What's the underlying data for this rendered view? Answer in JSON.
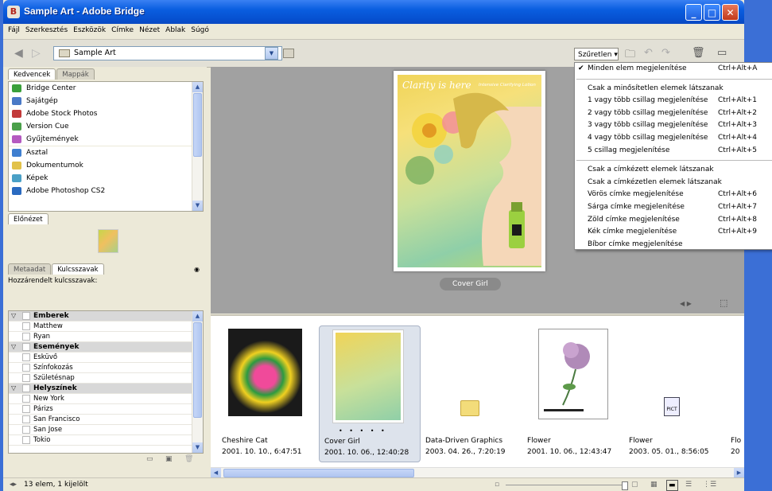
{
  "window": {
    "title": "Sample Art - Adobe Bridge"
  },
  "menubar": [
    "Fájl",
    "Szerkesztés",
    "Eszközök",
    "Címke",
    "Nézet",
    "Ablak",
    "Súgó"
  ],
  "path": {
    "current": "Sample Art"
  },
  "toolbar": {
    "filter_label": "Szűretlen"
  },
  "tabs": {
    "favorites": "Kedvencek",
    "folders": "Mappák",
    "preview": "Előnézet",
    "metadata": "Metaadat",
    "keywords": "Kulcsszavak"
  },
  "favorites": [
    {
      "label": "Bridge Center",
      "icon": "bridge-center-icon"
    },
    {
      "label": "Sajátgép",
      "icon": "computer-icon"
    },
    {
      "label": "Adobe Stock Photos",
      "icon": "stock-photos-icon"
    },
    {
      "label": "Version Cue",
      "icon": "version-cue-icon"
    },
    {
      "label": "Gyűjtemények",
      "icon": "collections-icon"
    },
    {
      "label": "Asztal",
      "icon": "desktop-icon"
    },
    {
      "label": "Dokumentumok",
      "icon": "documents-folder-icon"
    },
    {
      "label": "Képek",
      "icon": "pictures-folder-icon"
    },
    {
      "label": "Adobe Photoshop CS2",
      "icon": "photoshop-icon"
    }
  ],
  "keywords": {
    "assigned_label": "Hozzárendelt kulcsszavak:",
    "rows": [
      {
        "label": "Emberek",
        "category": true
      },
      {
        "label": "Matthew",
        "category": false
      },
      {
        "label": "Ryan",
        "category": false
      },
      {
        "label": "Események",
        "category": true
      },
      {
        "label": "Esküvő",
        "category": false
      },
      {
        "label": "Színfokozás",
        "category": false
      },
      {
        "label": "Születésnap",
        "category": false
      },
      {
        "label": "Helyszínek",
        "category": true
      },
      {
        "label": "New York",
        "category": false
      },
      {
        "label": "Párizs",
        "category": false
      },
      {
        "label": "San Francisco",
        "category": false
      },
      {
        "label": "San Jose",
        "category": false
      },
      {
        "label": "Tokio",
        "category": false
      }
    ]
  },
  "viewer": {
    "caption": "Cover Girl",
    "poster_headline": "Clarity is here",
    "poster_subline": "Intensive Clarifying Lotion"
  },
  "thumbnails": [
    {
      "name": "Cheshire Cat",
      "date": "2001. 10. 10., 6:47:51"
    },
    {
      "name": "Cover Girl",
      "date": "2001. 10. 06., 12:40:28"
    },
    {
      "name": "Data-Driven Graphics",
      "date": "2003. 04. 26., 7:20:19"
    },
    {
      "name": "Flower",
      "date": "2001. 10. 06., 12:43:47"
    },
    {
      "name": "Flower",
      "date": "2003. 05. 01., 8:56:05"
    },
    {
      "name": "Flo",
      "date": "20"
    }
  ],
  "pict_label": "PICT",
  "status": {
    "text": "13 elem, 1 kijelölt"
  },
  "filter_menu": {
    "items": [
      {
        "label": "Minden elem megjelenítése",
        "shortcut": "Ctrl+Alt+A",
        "checked": true
      },
      {
        "separator": true
      },
      {
        "label": "Csak a minősítetlen elemek látszanak",
        "shortcut": ""
      },
      {
        "label": "1 vagy több csillag megjelenítése",
        "shortcut": "Ctrl+Alt+1"
      },
      {
        "label": "2 vagy több csillag megjelenítése",
        "shortcut": "Ctrl+Alt+2"
      },
      {
        "label": "3 vagy több csillag megjelenítése",
        "shortcut": "Ctrl+Alt+3"
      },
      {
        "label": "4 vagy több csillag megjelenítése",
        "shortcut": "Ctrl+Alt+4"
      },
      {
        "label": "5 csillag megjelenítése",
        "shortcut": "Ctrl+Alt+5"
      },
      {
        "separator": true
      },
      {
        "label": "Csak a címkézett elemek látszanak",
        "shortcut": ""
      },
      {
        "label": "Csak a címkézetlen elemek látszanak",
        "shortcut": ""
      },
      {
        "label": "Vörös címke megjelenítése",
        "shortcut": "Ctrl+Alt+6"
      },
      {
        "label": "Sárga címke megjelenítése",
        "shortcut": "Ctrl+Alt+7"
      },
      {
        "label": "Zöld címke megjelenítése",
        "shortcut": "Ctrl+Alt+8"
      },
      {
        "label": "Kék címke megjelenítése",
        "shortcut": "Ctrl+Alt+9"
      },
      {
        "label": "Bíbor címke megjelenítése",
        "shortcut": ""
      }
    ]
  },
  "colors": {
    "titlebar": "#0a5ee0",
    "viewer_bg": "#a1a1a1",
    "accent": "#316ac5"
  }
}
